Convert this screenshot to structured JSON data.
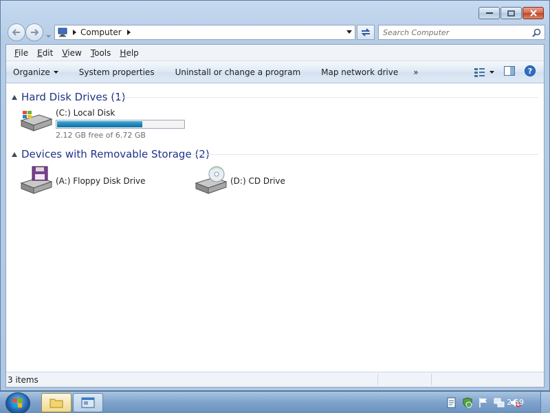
{
  "window": {
    "buttons": [
      "minimize",
      "maximize",
      "close"
    ]
  },
  "nav": {
    "address_crumb": "Computer",
    "search_placeholder": "Search Computer"
  },
  "menubar": {
    "items": [
      "File",
      "Edit",
      "View",
      "Tools",
      "Help"
    ]
  },
  "commandbar": {
    "organize": "Organize",
    "system_properties": "System properties",
    "uninstall": "Uninstall or change a program",
    "map_drive": "Map network drive",
    "more": "»"
  },
  "groups": {
    "hard_disks": {
      "title": "Hard Disk Drives (1)",
      "drives": [
        {
          "label": "(C:) Local Disk",
          "free_text": "2.12 GB free of 6.72 GB",
          "used_fraction": 0.68
        }
      ]
    },
    "removable": {
      "title": "Devices with Removable Storage (2)",
      "drives": [
        {
          "label": "(A:) Floppy Disk Drive"
        },
        {
          "label": "(D:) CD Drive"
        }
      ]
    }
  },
  "status": {
    "items_count": "3 items"
  },
  "taskbar": {
    "clock": "2:59"
  },
  "colors": {
    "accent": "#1e3287",
    "usage_fill": "#1f89bd"
  }
}
